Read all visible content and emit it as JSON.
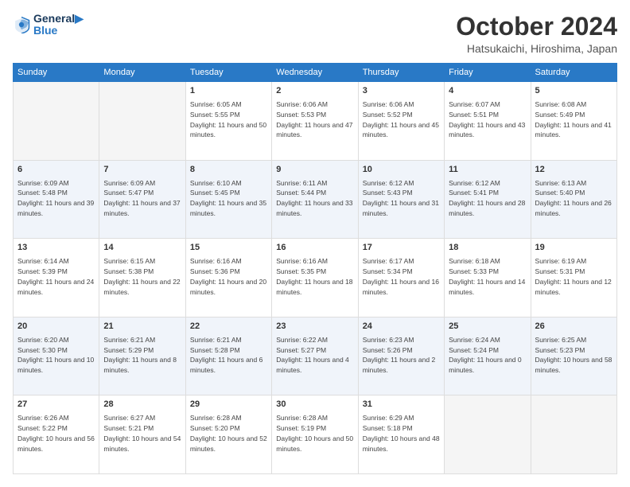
{
  "logo": {
    "line1": "General",
    "line2": "Blue"
  },
  "title": "October 2024",
  "location": "Hatsukaichi, Hiroshima, Japan",
  "headers": [
    "Sunday",
    "Monday",
    "Tuesday",
    "Wednesday",
    "Thursday",
    "Friday",
    "Saturday"
  ],
  "weeks": [
    [
      {
        "day": "",
        "info": ""
      },
      {
        "day": "",
        "info": ""
      },
      {
        "day": "1",
        "info": "Sunrise: 6:05 AM\nSunset: 5:55 PM\nDaylight: 11 hours and 50 minutes."
      },
      {
        "day": "2",
        "info": "Sunrise: 6:06 AM\nSunset: 5:53 PM\nDaylight: 11 hours and 47 minutes."
      },
      {
        "day": "3",
        "info": "Sunrise: 6:06 AM\nSunset: 5:52 PM\nDaylight: 11 hours and 45 minutes."
      },
      {
        "day": "4",
        "info": "Sunrise: 6:07 AM\nSunset: 5:51 PM\nDaylight: 11 hours and 43 minutes."
      },
      {
        "day": "5",
        "info": "Sunrise: 6:08 AM\nSunset: 5:49 PM\nDaylight: 11 hours and 41 minutes."
      }
    ],
    [
      {
        "day": "6",
        "info": "Sunrise: 6:09 AM\nSunset: 5:48 PM\nDaylight: 11 hours and 39 minutes."
      },
      {
        "day": "7",
        "info": "Sunrise: 6:09 AM\nSunset: 5:47 PM\nDaylight: 11 hours and 37 minutes."
      },
      {
        "day": "8",
        "info": "Sunrise: 6:10 AM\nSunset: 5:45 PM\nDaylight: 11 hours and 35 minutes."
      },
      {
        "day": "9",
        "info": "Sunrise: 6:11 AM\nSunset: 5:44 PM\nDaylight: 11 hours and 33 minutes."
      },
      {
        "day": "10",
        "info": "Sunrise: 6:12 AM\nSunset: 5:43 PM\nDaylight: 11 hours and 31 minutes."
      },
      {
        "day": "11",
        "info": "Sunrise: 6:12 AM\nSunset: 5:41 PM\nDaylight: 11 hours and 28 minutes."
      },
      {
        "day": "12",
        "info": "Sunrise: 6:13 AM\nSunset: 5:40 PM\nDaylight: 11 hours and 26 minutes."
      }
    ],
    [
      {
        "day": "13",
        "info": "Sunrise: 6:14 AM\nSunset: 5:39 PM\nDaylight: 11 hours and 24 minutes."
      },
      {
        "day": "14",
        "info": "Sunrise: 6:15 AM\nSunset: 5:38 PM\nDaylight: 11 hours and 22 minutes."
      },
      {
        "day": "15",
        "info": "Sunrise: 6:16 AM\nSunset: 5:36 PM\nDaylight: 11 hours and 20 minutes."
      },
      {
        "day": "16",
        "info": "Sunrise: 6:16 AM\nSunset: 5:35 PM\nDaylight: 11 hours and 18 minutes."
      },
      {
        "day": "17",
        "info": "Sunrise: 6:17 AM\nSunset: 5:34 PM\nDaylight: 11 hours and 16 minutes."
      },
      {
        "day": "18",
        "info": "Sunrise: 6:18 AM\nSunset: 5:33 PM\nDaylight: 11 hours and 14 minutes."
      },
      {
        "day": "19",
        "info": "Sunrise: 6:19 AM\nSunset: 5:31 PM\nDaylight: 11 hours and 12 minutes."
      }
    ],
    [
      {
        "day": "20",
        "info": "Sunrise: 6:20 AM\nSunset: 5:30 PM\nDaylight: 11 hours and 10 minutes."
      },
      {
        "day": "21",
        "info": "Sunrise: 6:21 AM\nSunset: 5:29 PM\nDaylight: 11 hours and 8 minutes."
      },
      {
        "day": "22",
        "info": "Sunrise: 6:21 AM\nSunset: 5:28 PM\nDaylight: 11 hours and 6 minutes."
      },
      {
        "day": "23",
        "info": "Sunrise: 6:22 AM\nSunset: 5:27 PM\nDaylight: 11 hours and 4 minutes."
      },
      {
        "day": "24",
        "info": "Sunrise: 6:23 AM\nSunset: 5:26 PM\nDaylight: 11 hours and 2 minutes."
      },
      {
        "day": "25",
        "info": "Sunrise: 6:24 AM\nSunset: 5:24 PM\nDaylight: 11 hours and 0 minutes."
      },
      {
        "day": "26",
        "info": "Sunrise: 6:25 AM\nSunset: 5:23 PM\nDaylight: 10 hours and 58 minutes."
      }
    ],
    [
      {
        "day": "27",
        "info": "Sunrise: 6:26 AM\nSunset: 5:22 PM\nDaylight: 10 hours and 56 minutes."
      },
      {
        "day": "28",
        "info": "Sunrise: 6:27 AM\nSunset: 5:21 PM\nDaylight: 10 hours and 54 minutes."
      },
      {
        "day": "29",
        "info": "Sunrise: 6:28 AM\nSunset: 5:20 PM\nDaylight: 10 hours and 52 minutes."
      },
      {
        "day": "30",
        "info": "Sunrise: 6:28 AM\nSunset: 5:19 PM\nDaylight: 10 hours and 50 minutes."
      },
      {
        "day": "31",
        "info": "Sunrise: 6:29 AM\nSunset: 5:18 PM\nDaylight: 10 hours and 48 minutes."
      },
      {
        "day": "",
        "info": ""
      },
      {
        "day": "",
        "info": ""
      }
    ]
  ]
}
